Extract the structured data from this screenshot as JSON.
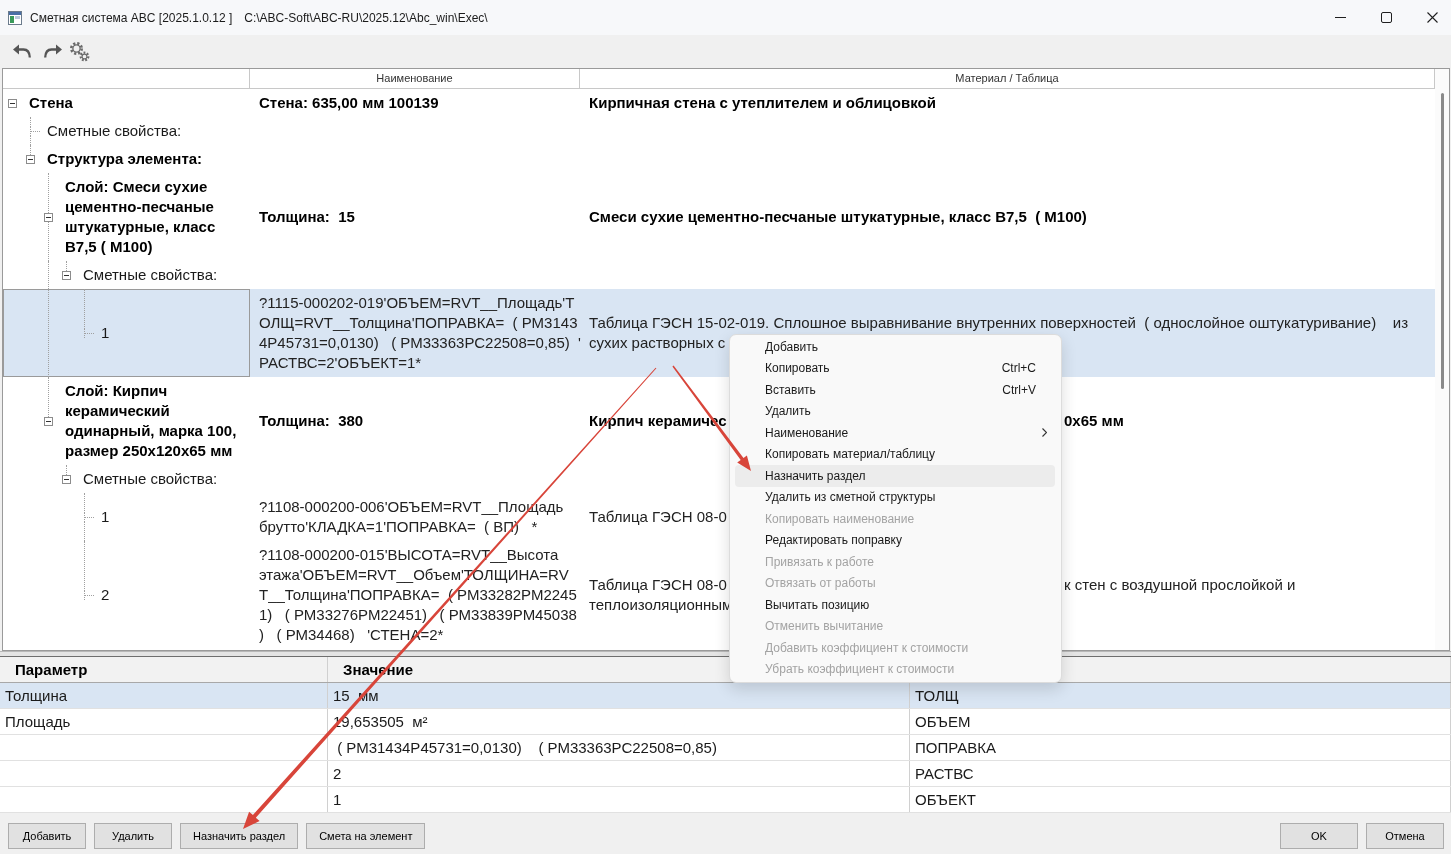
{
  "window": {
    "title": "Сметная система ABC [2025.1.0.12 ]",
    "path": "C:\\ABC-Soft\\ABC-RU\\2025.12\\Abc_win\\Exec\\"
  },
  "tree": {
    "columns": [
      "Наименование",
      "Материал / Таблица"
    ],
    "rows": [
      {
        "kind": "element",
        "label": "Стена",
        "expanded": true,
        "selected": false,
        "name": [
          "Стена: 635,00 мм 100139"
        ],
        "material": [
          "Кирпичная стена с утеплителем и облицовкой"
        ],
        "children": [
          {
            "kind": "properties",
            "label": "Сметные свойства:",
            "selected": false
          },
          {
            "kind": "structure",
            "label": "Структура элемента:",
            "expanded": true,
            "selected": false,
            "children": [
              {
                "kind": "layer",
                "label": "Слой: Смеси сухие цементно-песчаные штукатурные, класс В7,5  ( М100)",
                "expanded": true,
                "selected": false,
                "name": [
                  "Толщина:  15"
                ],
                "material": [
                  "Смеси сухие цементно-песчаные штукатурные, класс В7,5  ( М100)"
                ],
                "children": [
                  {
                    "kind": "properties",
                    "label": "Сметные свойства:",
                    "expanded": true,
                    "selected": false,
                    "children": [
                      {
                        "kind": "position",
                        "label": "1",
                        "selected": true,
                        "name": [
                          "?1115-000202-019'ОБЪЕМ=RVT__Площадь'Т",
                          "ОЛЩ=RVT__Толщина'ПОПРАВКА=  ( РМ3143",
                          "4Р45731=0,0130)   ( РМ33363РС22508=0,85)  '",
                          "РАСТВС=2'ОБЪЕКТ=1*"
                        ],
                        "material": [
                          "Таблица ГЭСН 15-02-019. Сплошное выравнивание внутренних поверхностей  ( однослойное оштукатуривание)    из",
                          "сухих растворных с"
                        ]
                      }
                    ]
                  }
                ]
              },
              {
                "kind": "layer",
                "label": "Слой: Кирпич керамический одинарный, марка 100, размер 250х120х65 мм",
                "expanded": true,
                "selected": false,
                "name": [
                  "Толщина:  380"
                ],
                "material": [
                  "Кирпич керамичес"
                ],
                "material_after_menu": [
                  "0х65 мм"
                ],
                "children": [
                  {
                    "kind": "properties",
                    "label": "Сметные свойства:",
                    "expanded": true,
                    "selected": false,
                    "children": [
                      {
                        "kind": "position",
                        "label": "1",
                        "selected": false,
                        "name": [
                          "?1108-000200-006'ОБЪЕМ=RVT__Площадь",
                          "брутто'КЛАДКА=1'ПОПРАВКА=  ( ВП)   *"
                        ],
                        "material": [
                          "Таблица ГЭСН 08-0"
                        ]
                      },
                      {
                        "kind": "position",
                        "label": "2",
                        "selected": false,
                        "name": [
                          "?1108-000200-015'ВЫСОТА=RVT__Высота",
                          "этажа'ОБЪЕМ=RVT__Объем'ТОЛЩИНА=RV",
                          "Т__Толщина'ПОПРАВКА=  ( РМ33282РМ2245",
                          "1)   ( РМ33276РМ22451)   ( РМ33839РМ45038",
                          ")   ( РМ34468)   'СТЕНА=2*"
                        ],
                        "material": [
                          "Таблица ГЭСН 08-0",
                          "теплоизоляционным"
                        ],
                        "material_after_menu": [
                          "к стен с воздушной прослойкой и"
                        ]
                      }
                    ]
                  }
                ]
              }
            ]
          }
        ]
      }
    ]
  },
  "parameters": {
    "columns": [
      "Параметр",
      "Значение"
    ],
    "rows": [
      {
        "parameter": "Толщина",
        "value": "15  мм",
        "column_3": "ТОЛЩ",
        "selected": true
      },
      {
        "parameter": "Площадь",
        "value": "19,653505  м²",
        "column_3": "ОБЪЕМ",
        "selected": false
      },
      {
        "value": " ( РМ31434Р45731=0,0130)    ( РМ33363РС22508=0,85)",
        "column_3": "ПОПРАВКА",
        "selected": false
      },
      {
        "value": "2",
        "column_3": "РАСТВС",
        "selected": false
      },
      {
        "value": "1",
        "column_3": "ОБЪЕКТ",
        "selected": false
      }
    ]
  },
  "buttons": {
    "left": [
      "Добавить",
      "Удалить",
      "Назначить раздел",
      "Смета на элемент"
    ],
    "right": [
      "OK",
      "Отмена"
    ]
  },
  "context_menu": {
    "items": [
      {
        "kind": "command",
        "label": "Добавить",
        "disabled": false,
        "highlighted": false
      },
      {
        "kind": "command",
        "label": "Копировать",
        "shortcut": "Ctrl+C",
        "disabled": false,
        "highlighted": false
      },
      {
        "kind": "command",
        "label": "Вставить",
        "shortcut": "Ctrl+V",
        "disabled": false,
        "highlighted": false
      },
      {
        "kind": "command",
        "label": "Удалить",
        "disabled": false,
        "highlighted": false
      },
      {
        "kind": "submenu",
        "label": "Наименование",
        "disabled": false,
        "highlighted": false
      },
      {
        "kind": "command",
        "label": "Копировать материал/таблицу",
        "disabled": false,
        "highlighted": false
      },
      {
        "kind": "command",
        "label": "Назначить раздел",
        "disabled": false,
        "highlighted": true
      },
      {
        "kind": "command",
        "label": "Удалить из сметной структуры",
        "disabled": false,
        "highlighted": false
      },
      {
        "kind": "command",
        "label": "Копировать наименование",
        "disabled": true,
        "highlighted": false
      },
      {
        "kind": "command",
        "label": "Редактировать поправку",
        "disabled": false,
        "highlighted": false
      },
      {
        "kind": "command",
        "label": "Привязать к работе",
        "disabled": true,
        "highlighted": false
      },
      {
        "kind": "command",
        "label": "Отвязать от работы",
        "disabled": true,
        "highlighted": false
      },
      {
        "kind": "command",
        "label": "Вычитать позицию",
        "disabled": false,
        "highlighted": false
      },
      {
        "kind": "command",
        "label": "Отменить вычитание",
        "disabled": true,
        "highlighted": false
      },
      {
        "kind": "command",
        "label": "Добавить коэффициент к стоимости",
        "disabled": true,
        "highlighted": false
      },
      {
        "kind": "command",
        "label": "Убрать коэффициент к стоимости",
        "disabled": true,
        "highlighted": false
      }
    ]
  },
  "annotations": [
    {
      "kind": "arrow"
    },
    {
      "kind": "arrow"
    }
  ]
}
